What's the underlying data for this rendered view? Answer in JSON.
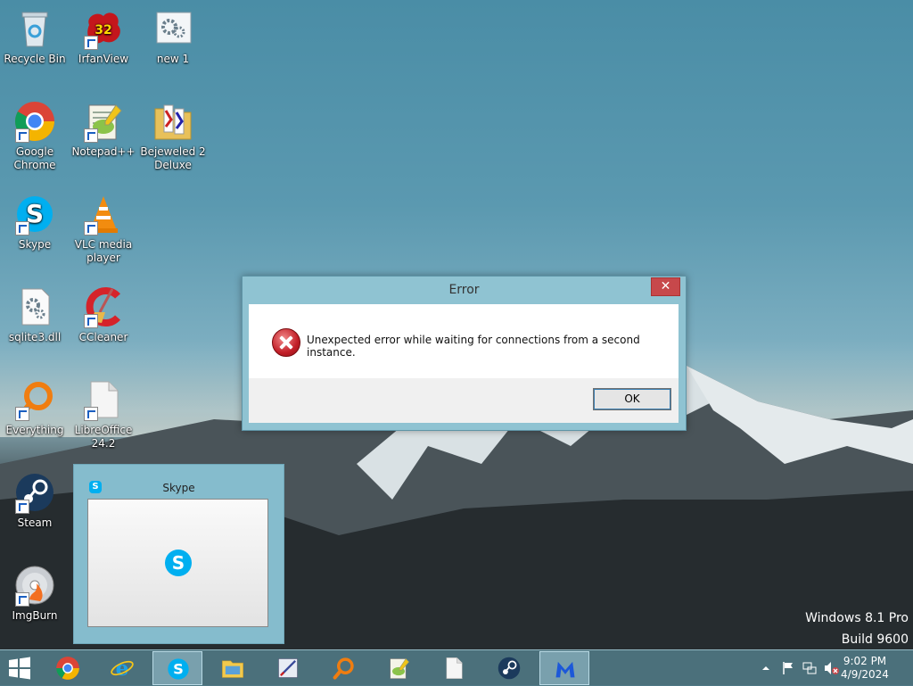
{
  "desktop_icons": [
    {
      "label": "Recycle Bin",
      "icon": "recycle-bin-icon",
      "shortcut": false
    },
    {
      "label": "IrfanView",
      "icon": "irfanview-icon",
      "shortcut": true,
      "badge": "32"
    },
    {
      "label": "new 1",
      "icon": "settings-file-icon",
      "shortcut": false
    },
    {
      "label": "Google Chrome",
      "icon": "chrome-icon",
      "shortcut": true
    },
    {
      "label": "Notepad++",
      "icon": "notepadpp-icon",
      "shortcut": true
    },
    {
      "label": "Bejeweled 2 Deluxe",
      "icon": "folder-icon",
      "shortcut": false
    },
    {
      "label": "Skype",
      "icon": "skype-icon",
      "shortcut": true
    },
    {
      "label": "VLC media player",
      "icon": "vlc-icon",
      "shortcut": true
    },
    {
      "label": "sqlite3.dll",
      "icon": "dll-file-icon",
      "shortcut": false
    },
    {
      "label": "CCleaner",
      "icon": "ccleaner-icon",
      "shortcut": true
    },
    {
      "label": "Everything",
      "icon": "everything-search-icon",
      "shortcut": true
    },
    {
      "label": "LibreOffice 24.2",
      "icon": "libreoffice-icon",
      "shortcut": true
    },
    {
      "label": "Steam",
      "icon": "steam-icon",
      "shortcut": true
    },
    {
      "label": "ImgBurn",
      "icon": "imgburn-disc-icon",
      "shortcut": true
    }
  ],
  "error_dialog": {
    "title": "Error",
    "close_glyph": "✕",
    "message": "Unexpected error while waiting for connections from a second instance.",
    "ok_label": "OK"
  },
  "skype_thumbnail": {
    "title": "Skype",
    "logo_letter": "S"
  },
  "watermark": {
    "line1": "Windows 8.1 Pro",
    "line2": "Build 9600"
  },
  "taskbar": {
    "items": [
      {
        "name": "start-button",
        "icon": "windows-logo-icon",
        "active": false
      },
      {
        "name": "chrome",
        "icon": "chrome-icon",
        "active": false
      },
      {
        "name": "internet-explorer",
        "icon": "ie-icon",
        "active": false
      },
      {
        "name": "skype",
        "icon": "skype-icon",
        "active": true
      },
      {
        "name": "file-explorer",
        "icon": "folder-icon",
        "active": false
      },
      {
        "name": "inkscape-tool",
        "icon": "pen-tool-icon",
        "active": false
      },
      {
        "name": "everything",
        "icon": "everything-search-icon",
        "active": false
      },
      {
        "name": "notepadpp",
        "icon": "notepadpp-icon",
        "active": false
      },
      {
        "name": "libreoffice",
        "icon": "document-icon",
        "active": false
      },
      {
        "name": "steam",
        "icon": "steam-icon",
        "active": false
      },
      {
        "name": "malwarebytes",
        "icon": "malwarebytes-icon",
        "active": true
      }
    ],
    "clock_time": "9:02 PM",
    "clock_date": "4/9/2024"
  },
  "colors": {
    "accent": "#8fc3d2",
    "close_red": "#c7484b",
    "taskbar": "#4e7682"
  }
}
